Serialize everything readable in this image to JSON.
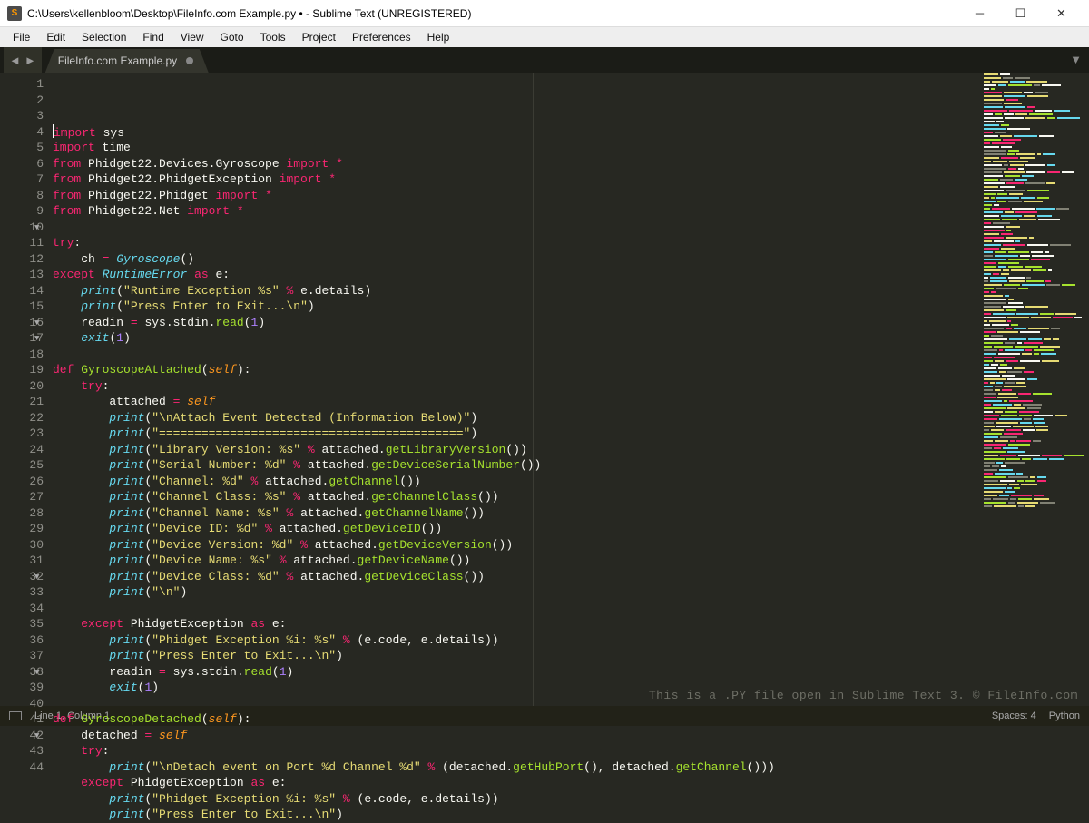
{
  "window": {
    "title": "C:\\Users\\kellenbloom\\Desktop\\FileInfo.com Example.py • - Sublime Text (UNREGISTERED)"
  },
  "menu": [
    "File",
    "Edit",
    "Selection",
    "Find",
    "View",
    "Goto",
    "Tools",
    "Project",
    "Preferences",
    "Help"
  ],
  "tab": {
    "label": "FileInfo.com Example.py"
  },
  "status": {
    "cursor": "Line 1, Column 1",
    "spaces": "Spaces: 4",
    "syntax": "Python"
  },
  "watermark": "This is a .PY file open in Sublime Text 3. © FileInfo.com",
  "fold_lines": [
    10,
    16,
    17,
    32,
    38,
    42
  ],
  "code": [
    [
      [
        "kw",
        "import"
      ],
      [
        "id",
        " sys"
      ]
    ],
    [
      [
        "kw",
        "import"
      ],
      [
        "id",
        " time"
      ]
    ],
    [
      [
        "kw",
        "from"
      ],
      [
        "id",
        " Phidget22.Devices.Gyroscope "
      ],
      [
        "kw",
        "import"
      ],
      [
        "id",
        " "
      ],
      [
        "op",
        "*"
      ]
    ],
    [
      [
        "kw",
        "from"
      ],
      [
        "id",
        " Phidget22.PhidgetException "
      ],
      [
        "kw",
        "import"
      ],
      [
        "id",
        " "
      ],
      [
        "op",
        "*"
      ]
    ],
    [
      [
        "kw",
        "from"
      ],
      [
        "id",
        " Phidget22.Phidget "
      ],
      [
        "kw",
        "import"
      ],
      [
        "id",
        " "
      ],
      [
        "op",
        "*"
      ]
    ],
    [
      [
        "kw",
        "from"
      ],
      [
        "id",
        " Phidget22.Net "
      ],
      [
        "kw",
        "import"
      ],
      [
        "id",
        " "
      ],
      [
        "op",
        "*"
      ]
    ],
    [],
    [
      [
        "kw",
        "try"
      ],
      [
        "id",
        ":"
      ]
    ],
    [
      [
        "id",
        "    ch "
      ],
      [
        "op",
        "="
      ],
      [
        "id",
        " "
      ],
      [
        "kwb",
        "Gyroscope"
      ],
      [
        "id",
        "()"
      ]
    ],
    [
      [
        "kw",
        "except"
      ],
      [
        "id",
        " "
      ],
      [
        "kwb",
        "RuntimeError"
      ],
      [
        "id",
        " "
      ],
      [
        "kw",
        "as"
      ],
      [
        "id",
        " e:"
      ]
    ],
    [
      [
        "id",
        "    "
      ],
      [
        "kwb",
        "print"
      ],
      [
        "id",
        "("
      ],
      [
        "str",
        "\"Runtime Exception %s\""
      ],
      [
        "id",
        " "
      ],
      [
        "op",
        "%"
      ],
      [
        "id",
        " e.details)"
      ]
    ],
    [
      [
        "id",
        "    "
      ],
      [
        "kwb",
        "print"
      ],
      [
        "id",
        "("
      ],
      [
        "str",
        "\"Press Enter to Exit...\\n\""
      ],
      [
        "id",
        ")"
      ]
    ],
    [
      [
        "id",
        "    readin "
      ],
      [
        "op",
        "="
      ],
      [
        "id",
        " sys.stdin."
      ],
      [
        "fn",
        "read"
      ],
      [
        "id",
        "("
      ],
      [
        "num",
        "1"
      ],
      [
        "id",
        ")"
      ]
    ],
    [
      [
        "id",
        "    "
      ],
      [
        "kwb",
        "exit"
      ],
      [
        "id",
        "("
      ],
      [
        "num",
        "1"
      ],
      [
        "id",
        ")"
      ]
    ],
    [],
    [
      [
        "kw",
        "def"
      ],
      [
        "id",
        " "
      ],
      [
        "fn",
        "GyroscopeAttached"
      ],
      [
        "id",
        "("
      ],
      [
        "param",
        "self"
      ],
      [
        "id",
        "):"
      ]
    ],
    [
      [
        "id",
        "    "
      ],
      [
        "kw",
        "try"
      ],
      [
        "id",
        ":"
      ]
    ],
    [
      [
        "id",
        "        attached "
      ],
      [
        "op",
        "="
      ],
      [
        "id",
        " "
      ],
      [
        "param",
        "self"
      ]
    ],
    [
      [
        "id",
        "        "
      ],
      [
        "kwb",
        "print"
      ],
      [
        "id",
        "("
      ],
      [
        "str",
        "\"\\nAttach Event Detected (Information Below)\""
      ],
      [
        "id",
        ")"
      ]
    ],
    [
      [
        "id",
        "        "
      ],
      [
        "kwb",
        "print"
      ],
      [
        "id",
        "("
      ],
      [
        "str",
        "\"===========================================\""
      ],
      [
        "id",
        ")"
      ]
    ],
    [
      [
        "id",
        "        "
      ],
      [
        "kwb",
        "print"
      ],
      [
        "id",
        "("
      ],
      [
        "str",
        "\"Library Version: %s\""
      ],
      [
        "id",
        " "
      ],
      [
        "op",
        "%"
      ],
      [
        "id",
        " attached."
      ],
      [
        "fn",
        "getLibraryVersion"
      ],
      [
        "id",
        "())"
      ]
    ],
    [
      [
        "id",
        "        "
      ],
      [
        "kwb",
        "print"
      ],
      [
        "id",
        "("
      ],
      [
        "str",
        "\"Serial Number: %d\""
      ],
      [
        "id",
        " "
      ],
      [
        "op",
        "%"
      ],
      [
        "id",
        " attached."
      ],
      [
        "fn",
        "getDeviceSerialNumber"
      ],
      [
        "id",
        "())"
      ]
    ],
    [
      [
        "id",
        "        "
      ],
      [
        "kwb",
        "print"
      ],
      [
        "id",
        "("
      ],
      [
        "str",
        "\"Channel: %d\""
      ],
      [
        "id",
        " "
      ],
      [
        "op",
        "%"
      ],
      [
        "id",
        " attached."
      ],
      [
        "fn",
        "getChannel"
      ],
      [
        "id",
        "())"
      ]
    ],
    [
      [
        "id",
        "        "
      ],
      [
        "kwb",
        "print"
      ],
      [
        "id",
        "("
      ],
      [
        "str",
        "\"Channel Class: %s\""
      ],
      [
        "id",
        " "
      ],
      [
        "op",
        "%"
      ],
      [
        "id",
        " attached."
      ],
      [
        "fn",
        "getChannelClass"
      ],
      [
        "id",
        "())"
      ]
    ],
    [
      [
        "id",
        "        "
      ],
      [
        "kwb",
        "print"
      ],
      [
        "id",
        "("
      ],
      [
        "str",
        "\"Channel Name: %s\""
      ],
      [
        "id",
        " "
      ],
      [
        "op",
        "%"
      ],
      [
        "id",
        " attached."
      ],
      [
        "fn",
        "getChannelName"
      ],
      [
        "id",
        "())"
      ]
    ],
    [
      [
        "id",
        "        "
      ],
      [
        "kwb",
        "print"
      ],
      [
        "id",
        "("
      ],
      [
        "str",
        "\"Device ID: %d\""
      ],
      [
        "id",
        " "
      ],
      [
        "op",
        "%"
      ],
      [
        "id",
        " attached."
      ],
      [
        "fn",
        "getDeviceID"
      ],
      [
        "id",
        "())"
      ]
    ],
    [
      [
        "id",
        "        "
      ],
      [
        "kwb",
        "print"
      ],
      [
        "id",
        "("
      ],
      [
        "str",
        "\"Device Version: %d\""
      ],
      [
        "id",
        " "
      ],
      [
        "op",
        "%"
      ],
      [
        "id",
        " attached."
      ],
      [
        "fn",
        "getDeviceVersion"
      ],
      [
        "id",
        "())"
      ]
    ],
    [
      [
        "id",
        "        "
      ],
      [
        "kwb",
        "print"
      ],
      [
        "id",
        "("
      ],
      [
        "str",
        "\"Device Name: %s\""
      ],
      [
        "id",
        " "
      ],
      [
        "op",
        "%"
      ],
      [
        "id",
        " attached."
      ],
      [
        "fn",
        "getDeviceName"
      ],
      [
        "id",
        "())"
      ]
    ],
    [
      [
        "id",
        "        "
      ],
      [
        "kwb",
        "print"
      ],
      [
        "id",
        "("
      ],
      [
        "str",
        "\"Device Class: %d\""
      ],
      [
        "id",
        " "
      ],
      [
        "op",
        "%"
      ],
      [
        "id",
        " attached."
      ],
      [
        "fn",
        "getDeviceClass"
      ],
      [
        "id",
        "())"
      ]
    ],
    [
      [
        "id",
        "        "
      ],
      [
        "kwb",
        "print"
      ],
      [
        "id",
        "("
      ],
      [
        "str",
        "\"\\n\""
      ],
      [
        "id",
        ")"
      ]
    ],
    [],
    [
      [
        "id",
        "    "
      ],
      [
        "kw",
        "except"
      ],
      [
        "id",
        " PhidgetException "
      ],
      [
        "kw",
        "as"
      ],
      [
        "id",
        " e:"
      ]
    ],
    [
      [
        "id",
        "        "
      ],
      [
        "kwb",
        "print"
      ],
      [
        "id",
        "("
      ],
      [
        "str",
        "\"Phidget Exception %i: %s\""
      ],
      [
        "id",
        " "
      ],
      [
        "op",
        "%"
      ],
      [
        "id",
        " (e.code, e.details))"
      ]
    ],
    [
      [
        "id",
        "        "
      ],
      [
        "kwb",
        "print"
      ],
      [
        "id",
        "("
      ],
      [
        "str",
        "\"Press Enter to Exit...\\n\""
      ],
      [
        "id",
        ")"
      ]
    ],
    [
      [
        "id",
        "        readin "
      ],
      [
        "op",
        "="
      ],
      [
        "id",
        " sys.stdin."
      ],
      [
        "fn",
        "read"
      ],
      [
        "id",
        "("
      ],
      [
        "num",
        "1"
      ],
      [
        "id",
        ")"
      ]
    ],
    [
      [
        "id",
        "        "
      ],
      [
        "kwb",
        "exit"
      ],
      [
        "id",
        "("
      ],
      [
        "num",
        "1"
      ],
      [
        "id",
        ")"
      ]
    ],
    [],
    [
      [
        "kw",
        "def"
      ],
      [
        "id",
        " "
      ],
      [
        "fn",
        "GyroscopeDetached"
      ],
      [
        "id",
        "("
      ],
      [
        "param",
        "self"
      ],
      [
        "id",
        "):"
      ]
    ],
    [
      [
        "id",
        "    detached "
      ],
      [
        "op",
        "="
      ],
      [
        "id",
        " "
      ],
      [
        "param",
        "self"
      ]
    ],
    [
      [
        "id",
        "    "
      ],
      [
        "kw",
        "try"
      ],
      [
        "id",
        ":"
      ]
    ],
    [
      [
        "id",
        "        "
      ],
      [
        "kwb",
        "print"
      ],
      [
        "id",
        "("
      ],
      [
        "str",
        "\"\\nDetach event on Port %d Channel %d\""
      ],
      [
        "id",
        " "
      ],
      [
        "op",
        "%"
      ],
      [
        "id",
        " (detached."
      ],
      [
        "fn",
        "getHubPort"
      ],
      [
        "id",
        "(), detached."
      ],
      [
        "fn",
        "getChannel"
      ],
      [
        "id",
        "()))"
      ]
    ],
    [
      [
        "id",
        "    "
      ],
      [
        "kw",
        "except"
      ],
      [
        "id",
        " PhidgetException "
      ],
      [
        "kw",
        "as"
      ],
      [
        "id",
        " e:"
      ]
    ],
    [
      [
        "id",
        "        "
      ],
      [
        "kwb",
        "print"
      ],
      [
        "id",
        "("
      ],
      [
        "str",
        "\"Phidget Exception %i: %s\""
      ],
      [
        "id",
        " "
      ],
      [
        "op",
        "%"
      ],
      [
        "id",
        " (e.code, e.details))"
      ]
    ],
    [
      [
        "id",
        "        "
      ],
      [
        "kwb",
        "print"
      ],
      [
        "id",
        "("
      ],
      [
        "str",
        "\"Press Enter to Exit...\\n\""
      ],
      [
        "id",
        ")"
      ]
    ]
  ],
  "minimap_palette": [
    "#f92672",
    "#66d9ef",
    "#a6e22e",
    "#e6db74",
    "#818174",
    "#f8f8f2"
  ]
}
